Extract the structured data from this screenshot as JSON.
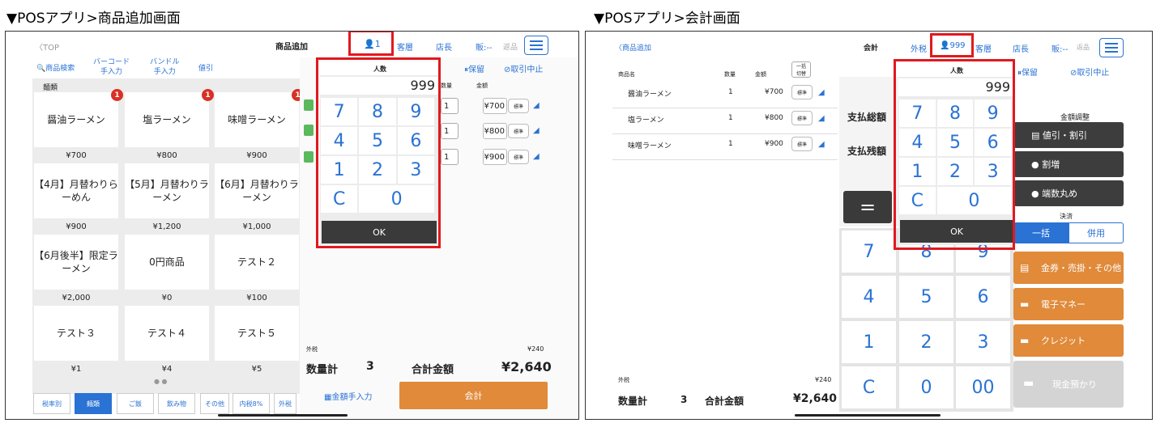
{
  "captions": {
    "left": "▼POSアプリ>商品追加画面",
    "right": "▼POSアプリ>会計画面"
  },
  "left": {
    "back": "〈TOP",
    "title": "商品追加",
    "people": "1",
    "guest": "客層",
    "manager": "店長",
    "sales": "販:--",
    "return": "返品",
    "toolbar": {
      "search": "商品検索",
      "barcode": "バーコード\n手入力",
      "bundle": "バンドル\n手入力",
      "discount": "値引"
    },
    "category": "麺類",
    "products": [
      {
        "name": "醤油ラーメン",
        "price": "¥700",
        "badge": "1"
      },
      {
        "name": "塩ラーメン",
        "price": "¥800",
        "badge": "1"
      },
      {
        "name": "味噌ラーメン",
        "price": "¥900",
        "badge": "1"
      },
      {
        "name": "【4月】月替わりら\nーめん",
        "price": "¥900"
      },
      {
        "name": "【5月】月替わりラ\nーメン",
        "price": "¥1,200"
      },
      {
        "name": "【6月】月替わりラ\nーメン",
        "price": "¥1,000"
      },
      {
        "name": "【6月後半】限定ラ\nーメン",
        "price": "¥2,000"
      },
      {
        "name": "0円商品",
        "price": "¥0"
      },
      {
        "name": "テスト２",
        "price": "¥100"
      },
      {
        "name": "テスト３",
        "price": "¥1"
      },
      {
        "name": "テスト４",
        "price": "¥4"
      },
      {
        "name": "テスト５",
        "price": "¥5"
      }
    ],
    "tabs": [
      "税率別",
      "麺類",
      "ご飯",
      "飲み物",
      "その他",
      "内税8%",
      "外税"
    ],
    "hold": "保留",
    "cancel": "取引中止",
    "col_qty": "数量",
    "col_amount": "金額",
    "lines": [
      {
        "qty": "1",
        "price": "¥700",
        "std": "標準"
      },
      {
        "qty": "1",
        "price": "¥800",
        "std": "標準"
      },
      {
        "qty": "1",
        "price": "¥900",
        "std": "標準"
      }
    ],
    "tax_label": "外税",
    "tax_value": "¥240",
    "qty_total_label": "数量計",
    "qty_total": "3",
    "total_label": "合計金額",
    "total": "¥2,640",
    "manual_amount": "金額手入力",
    "checkout": "会計",
    "popup": {
      "title": "人数",
      "value": "999",
      "keys": [
        "7",
        "8",
        "9",
        "4",
        "5",
        "6",
        "1",
        "2",
        "3",
        "C",
        "0"
      ],
      "ok": "OK"
    }
  },
  "right": {
    "back": "〈商品追加",
    "title": "会計",
    "tax_mode": "外税",
    "people": "999",
    "guest": "客層",
    "manager": "店長",
    "sales": "販:--",
    "return": "返品",
    "cols": {
      "name": "商品名",
      "qty": "数量",
      "amount": "金額",
      "bulk": "一括\n切替"
    },
    "lines": [
      {
        "name": "醤油ラーメン",
        "qty": "1",
        "price": "¥700",
        "std": "標準"
      },
      {
        "name": "塩ラーメン",
        "qty": "1",
        "price": "¥800",
        "std": "標準"
      },
      {
        "name": "味噌ラーメン",
        "qty": "1",
        "price": "¥900",
        "std": "標準"
      }
    ],
    "pay_total": "支払総額",
    "pay_remaining": "支払残額",
    "equals": "=",
    "hold": "保留",
    "cancel": "取引中止",
    "adjust_title": "金額調整",
    "discount": "値引・割引",
    "surcharge": "割増",
    "rounding": "端数丸め",
    "settle_title": "決済",
    "lump": "一括",
    "combined": "併用",
    "voucher": "金券・売掛・その他",
    "emoney": "電子マネー",
    "credit": "クレジット",
    "cash": "現金預かり",
    "keypad": [
      "7",
      "8",
      "9",
      "4",
      "5",
      "6",
      "1",
      "2",
      "3",
      "C",
      "0",
      "00"
    ],
    "tax_label": "外税",
    "tax_value": "¥240",
    "qty_total_label": "数量計",
    "qty_total": "3",
    "total_label": "合計金額",
    "total": "¥2,640",
    "popup": {
      "title": "人数",
      "value": "999",
      "keys": [
        "7",
        "8",
        "9",
        "4",
        "5",
        "6",
        "1",
        "2",
        "3",
        "C",
        "0"
      ],
      "ok": "OK"
    }
  }
}
